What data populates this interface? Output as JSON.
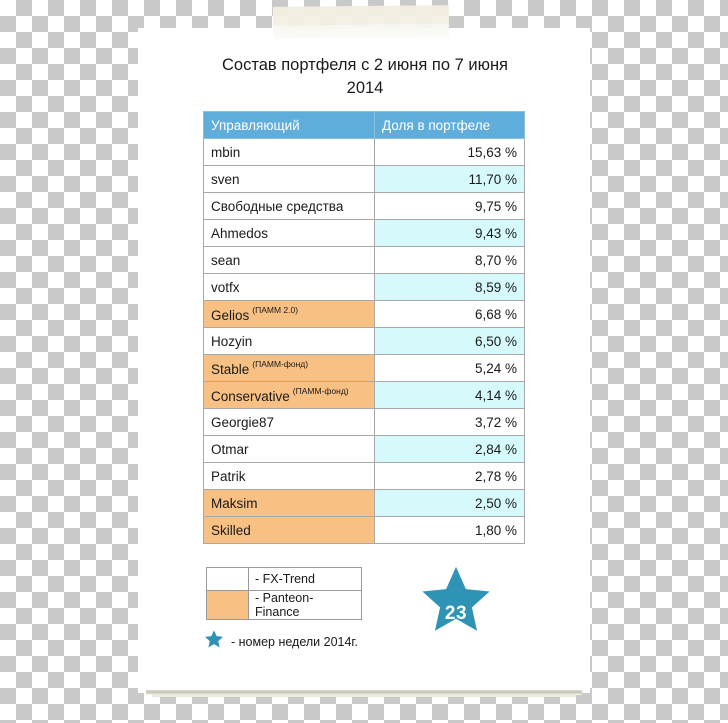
{
  "document": {
    "title_line1": "Состав портфеля с 2 июня по 7 июня",
    "title_line2": "2014"
  },
  "table": {
    "headers": {
      "manager": "Управляющий",
      "share": "Доля в портфеле"
    },
    "rows": [
      {
        "name": "mbin",
        "annotation": "",
        "share": "15,63 %",
        "highlight": "white",
        "alt": false
      },
      {
        "name": "sven",
        "annotation": "",
        "share": "11,70 %",
        "highlight": "white",
        "alt": true
      },
      {
        "name": "Свободные средства",
        "annotation": "",
        "share": "9,75 %",
        "highlight": "white",
        "alt": false
      },
      {
        "name": "Ahmedos",
        "annotation": "",
        "share": "9,43 %",
        "highlight": "white",
        "alt": true
      },
      {
        "name": "sean",
        "annotation": "",
        "share": "8,70 %",
        "highlight": "white",
        "alt": false
      },
      {
        "name": "votfx",
        "annotation": "",
        "share": "8,59 %",
        "highlight": "white",
        "alt": true
      },
      {
        "name": "Gelios",
        "annotation": "(ПАММ 2.0)",
        "share": "6,68 %",
        "highlight": "orange",
        "alt": false
      },
      {
        "name": "Hozyin",
        "annotation": "",
        "share": "6,50 %",
        "highlight": "white",
        "alt": true
      },
      {
        "name": "Stable",
        "annotation": "(ПАММ-фонд)",
        "share": "5,24 %",
        "highlight": "orange",
        "alt": false
      },
      {
        "name": "Conservative",
        "annotation": "(ПАММ-фонд)",
        "share": "4,14 %",
        "highlight": "orange",
        "alt": true
      },
      {
        "name": "Georgie87",
        "annotation": "",
        "share": "3,72 %",
        "highlight": "white",
        "alt": false
      },
      {
        "name": "Otmar",
        "annotation": "",
        "share": "2,84 %",
        "highlight": "white",
        "alt": true
      },
      {
        "name": "Patrik",
        "annotation": "",
        "share": "2,78 %",
        "highlight": "white",
        "alt": false
      },
      {
        "name": "Maksim",
        "annotation": "",
        "share": "2,50 %",
        "highlight": "orange",
        "alt": true
      },
      {
        "name": "Skilled",
        "annotation": "",
        "share": "1,80 %",
        "highlight": "orange",
        "alt": false
      }
    ]
  },
  "legend": {
    "items": [
      {
        "swatch": "white",
        "label": "- FX-Trend"
      },
      {
        "swatch": "orange",
        "label": "- Panteon-Finance"
      }
    ],
    "star_note": "- номер недели 2014г."
  },
  "week_badge": {
    "number": "23"
  },
  "colors": {
    "header_blue": "#5FADDB",
    "row_cyan": "#D6FAFC",
    "highlight_orange": "#F8C083",
    "star_teal": "#2E93B5",
    "tape_beige": "#F3EFE2"
  },
  "chart_data": {
    "type": "table",
    "title": "Состав портфеля с 2 июня по 7 июня 2014",
    "categories": [
      "mbin",
      "sven",
      "Свободные средства",
      "Ahmedos",
      "sean",
      "votfx",
      "Gelios",
      "Hozyin",
      "Stable",
      "Conservative",
      "Georgie87",
      "Otmar",
      "Patrik",
      "Maksim",
      "Skilled"
    ],
    "values": [
      15.63,
      11.7,
      9.75,
      9.43,
      8.7,
      8.59,
      6.68,
      6.5,
      5.24,
      4.14,
      3.72,
      2.84,
      2.78,
      2.5,
      1.8
    ],
    "ylabel": "Доля в портфеле",
    "unit": "%",
    "groups": {
      "FX-Trend": [
        "mbin",
        "sven",
        "Свободные средства",
        "Ahmedos",
        "sean",
        "votfx",
        "Hozyin",
        "Georgie87",
        "Otmar",
        "Patrik"
      ],
      "Panteon-Finance": [
        "Gelios",
        "Stable",
        "Conservative",
        "Maksim",
        "Skilled"
      ]
    },
    "week_number": 23,
    "year": 2014
  }
}
